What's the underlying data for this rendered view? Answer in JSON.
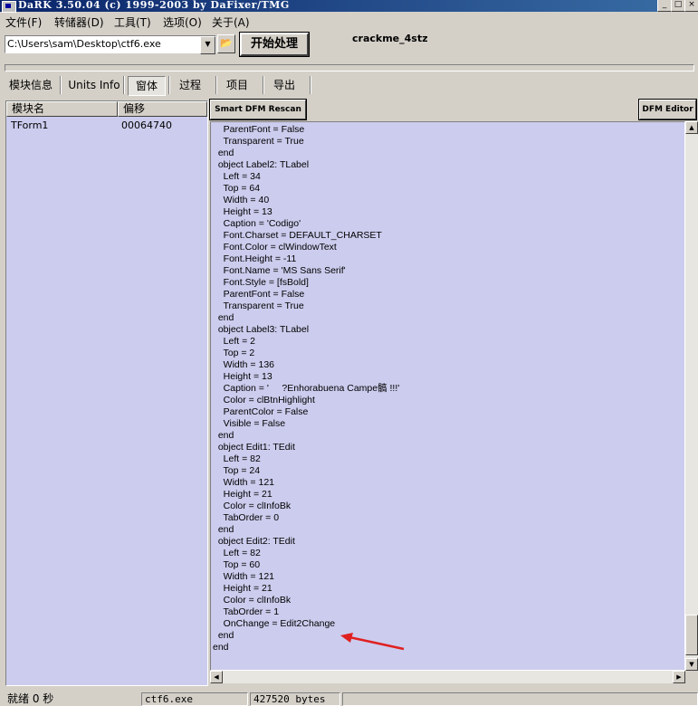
{
  "window": {
    "title": "DaRK 3.50.04 (c) 1999-2003 by DaFixer/TMG",
    "controls": [
      "_",
      "□",
      "×"
    ]
  },
  "menu": [
    "文件(F)",
    "转储器(D)",
    "工具(T)",
    "选项(O)",
    "关于(A)"
  ],
  "toolbar": {
    "path_value": "C:\\Users\\sam\\Desktop\\ctf6.exe",
    "start_label": "开始处理",
    "target_name": "crackme_4stz"
  },
  "tabs": [
    {
      "label": "模块信息",
      "active": false
    },
    {
      "label": "Units Info",
      "active": false
    },
    {
      "label": "窗体",
      "active": true
    },
    {
      "label": "过程",
      "active": false
    },
    {
      "label": "项目",
      "active": false
    },
    {
      "label": "导出",
      "active": false
    }
  ],
  "forms_list": {
    "columns": [
      "模块名",
      "偏移"
    ],
    "rows": [
      [
        "TForm1",
        "00064740"
      ]
    ]
  },
  "buttons": {
    "smart_rescan": "Smart DFM Rescan",
    "dfm_editor": "DFM Editor"
  },
  "dfm_lines": [
    "    ParentFont = False",
    "    Transparent = True",
    "  end",
    "  object Label2: TLabel",
    "    Left = 34",
    "    Top = 64",
    "    Width = 40",
    "    Height = 13",
    "    Caption = 'Codigo'",
    "    Font.Charset = DEFAULT_CHARSET",
    "    Font.Color = clWindowText",
    "    Font.Height = -11",
    "    Font.Name = 'MS Sans Serif'",
    "    Font.Style = [fsBold]",
    "    ParentFont = False",
    "    Transparent = True",
    "  end",
    "  object Label3: TLabel",
    "    Left = 2",
    "    Top = 2",
    "    Width = 136",
    "    Height = 13",
    "    Caption = '     ?Enhorabuena Campe髇 !!!'",
    "    Color = clBtnHighlight",
    "    ParentColor = False",
    "    Visible = False",
    "  end",
    "  object Edit1: TEdit",
    "    Left = 82",
    "    Top = 24",
    "    Width = 121",
    "    Height = 21",
    "    Color = clInfoBk",
    "    TabOrder = 0",
    "  end",
    "  object Edit2: TEdit",
    "    Left = 82",
    "    Top = 60",
    "    Width = 121",
    "    Height = 21",
    "    Color = clInfoBk",
    "    TabOrder = 1",
    "    OnChange = Edit2Change",
    "  end",
    "end"
  ],
  "annotation": {
    "arrow_color": "#e02020"
  },
  "status": {
    "state": "就绪 0 秒",
    "file": "ctf6.exe",
    "size": "427520 bytes"
  },
  "colors": {
    "panel_bg": "#ccccee",
    "titlebar": "#0a246a",
    "face": "#d4d0c8"
  }
}
